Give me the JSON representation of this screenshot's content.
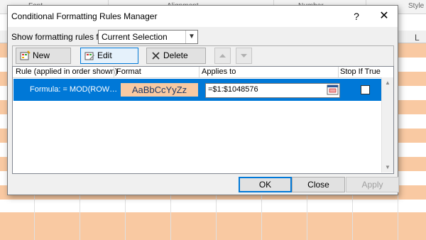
{
  "ribbon": {
    "groups": [
      "Font",
      "Alignment",
      "Number",
      "Style"
    ]
  },
  "sheet": {
    "visible_column": "L"
  },
  "dialog": {
    "title": "Conditional Formatting Rules Manager",
    "help_glyph": "?",
    "close_glyph": "✕",
    "show_rules_label": "Show formatting rules for:",
    "show_rules_value": "Current Selection",
    "toolbar": {
      "new_rule": "New Rule...",
      "edit_rule": "Edit Rule...",
      "delete_rule": "Delete Rule"
    },
    "columns": {
      "rule": "Rule (applied in order shown)",
      "format": "Format",
      "applies_to": "Applies to",
      "stop_if_true": "Stop If True"
    },
    "rules": [
      {
        "rule": "Formula: = MOD(ROW…",
        "format_preview": "AaBbCcYyZz",
        "applies_to": "=$1:$1048576",
        "stop_if_true": false
      }
    ],
    "buttons": {
      "ok": "OK",
      "close": "Close",
      "apply": "Apply"
    }
  },
  "colors": {
    "accent": "#0078d7",
    "highlight_fill": "#f9c9a2",
    "format_text": "#1f3864"
  }
}
